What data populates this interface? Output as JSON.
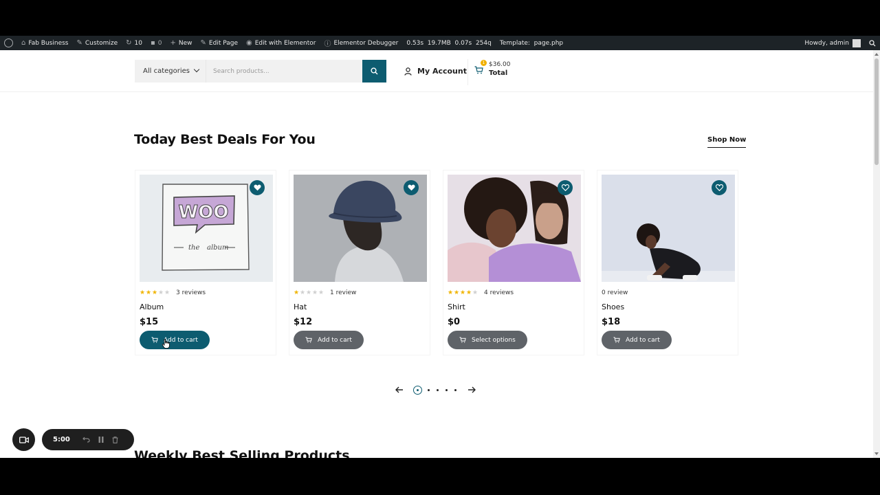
{
  "admin_bar": {
    "site_name": "Fab Business",
    "customize": "Customize",
    "updates_count": "10",
    "comments_count": "0",
    "new": "New",
    "edit_page": "Edit Page",
    "edit_elementor": "Edit with Elementor",
    "debugger": "Elementor Debugger",
    "stats": "0.53s  19.7MB  0.07s  254q",
    "template": "Template:  page.php",
    "howdy": "Howdy, admin"
  },
  "header": {
    "category_select": "All categories",
    "search_placeholder": "Search products...",
    "account_label": "My Account",
    "cart_amount": "$36.00",
    "cart_total_label": "Total",
    "cart_count": "1"
  },
  "section": {
    "title": "Today Best Deals For You",
    "shop_now": "Shop Now"
  },
  "products": [
    {
      "name": "Album",
      "reviews": "3 reviews",
      "price": "$15",
      "button": "Add to cart",
      "rating": 3
    },
    {
      "name": "Hat",
      "reviews": "1 review",
      "price": "$12",
      "button": "Add to cart",
      "rating": 1
    },
    {
      "name": "Shirt",
      "reviews": "4 reviews",
      "price": "$0",
      "button": "Select options",
      "rating": 4
    },
    {
      "name": "Shoes",
      "reviews": "0 review",
      "price": "$18",
      "button": "Add to cart",
      "rating": 0
    }
  ],
  "album_art": {
    "logo_text": "WOO",
    "caption_left": "the",
    "caption_right": "album"
  },
  "next_section_title": "Weekly Best Selling Products",
  "recorder": {
    "timer": "5:00"
  },
  "colors": {
    "accent": "#0d5c70",
    "button_gray": "#5f6368",
    "star": "#f0b400"
  }
}
